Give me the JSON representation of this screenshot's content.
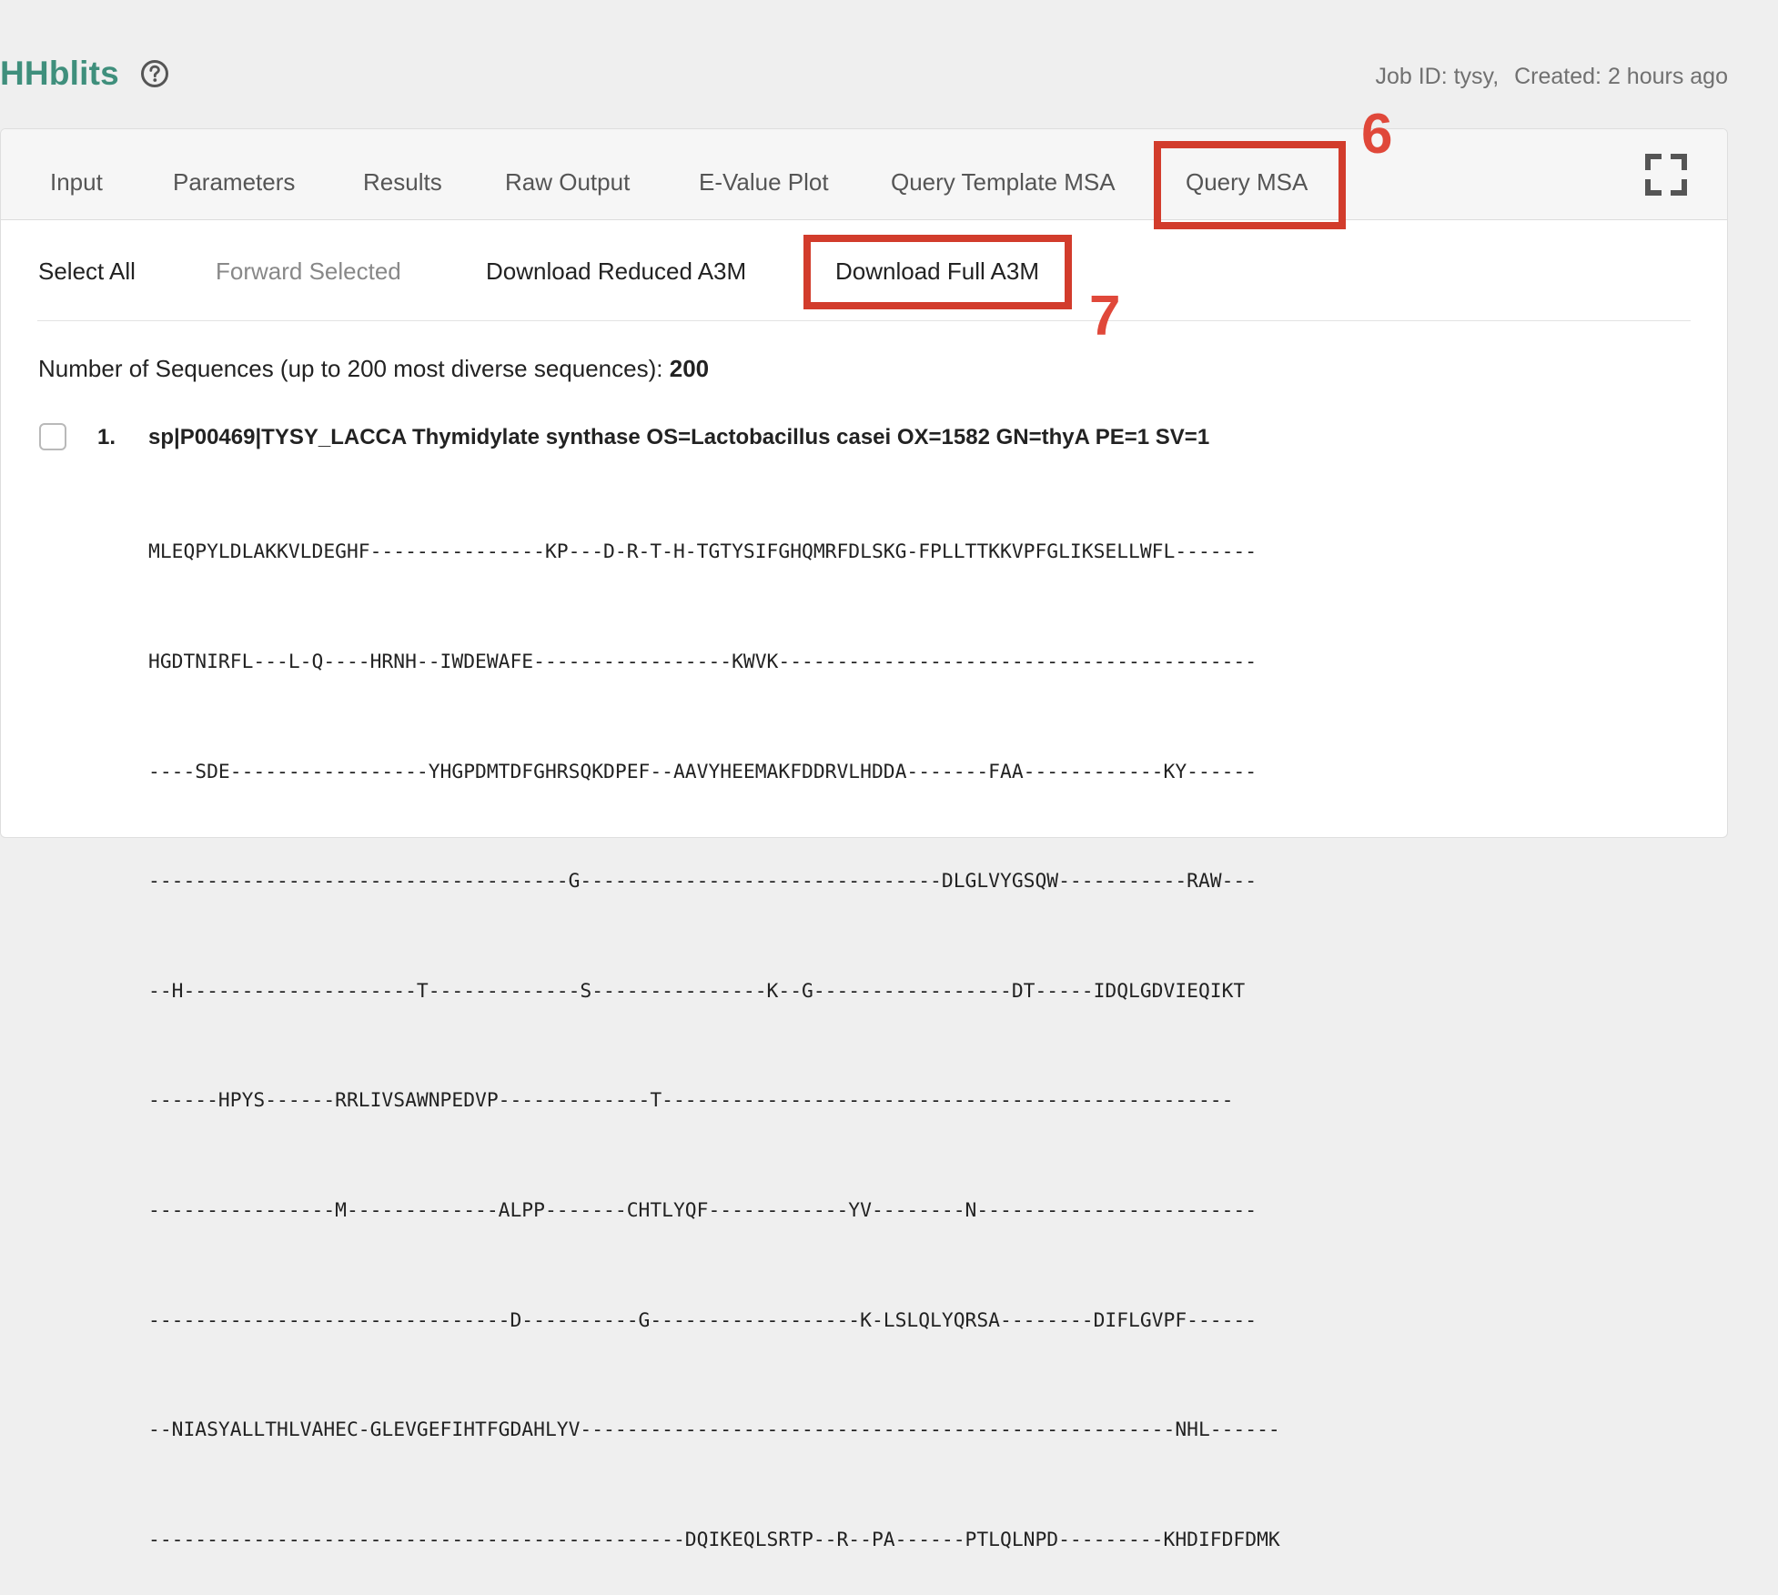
{
  "app": {
    "title": "HHblits",
    "job_id": "Job ID: tysy,",
    "created": "Created: 2 hours ago"
  },
  "tabs": [
    {
      "label": "Input"
    },
    {
      "label": "Parameters"
    },
    {
      "label": "Results"
    },
    {
      "label": "Raw Output"
    },
    {
      "label": "E-Value Plot"
    },
    {
      "label": "Query Template MSA"
    },
    {
      "label": "Query MSA",
      "active": true
    }
  ],
  "actions": {
    "select_all": "Select All",
    "forward_selected": "Forward Selected",
    "download_reduced": "Download Reduced A3M",
    "download_full": "Download Full A3M"
  },
  "annotations": {
    "six": "6",
    "seven": "7",
    "color": "#d23c2c"
  },
  "summary": {
    "label": "Number of Sequences (up to 200 most diverse sequences):",
    "value": "200"
  },
  "sequence": {
    "index": "1.",
    "header": "sp|P00469|TYSY_LACCA Thymidylate synthase OS=Lactobacillus casei OX=1582 GN=thyA PE=1 SV=1",
    "lines": [
      "MLEQPYLDLAKKVLDEGHF---------------KP---D-R-T-H-TGTYSIFGHQMRFDLSKG-FPLLTTKKVPFGLIKSELLWFL-------",
      "HGDTNIRFL---L-Q----HRNH--IWDEWAFE-----------------KWVK-----------------------------------------",
      "----SDE-----------------YHGPDMTDFGHRSQKDPEF--AAVYHEEMAKFDDRVLHDDA-------FAA------------KY------",
      "------------------------------------G-------------------------------DLGLVYGSQW-----------RAW---",
      "--H--------------------T-------------S---------------K--G-----------------DT-----IDQLGDVIEQIKT",
      "------HPYS------RRLIVSAWNPEDVP-------------T-------------------------------------------------",
      "----------------M-------------ALPP-------CHTLYQF------------YV--------N------------------------",
      "-------------------------------D----------G------------------K-LSLQLYQRSA--------DIFLGVPF------",
      "--NIASYALLTHLVAHEC-GLEVGEFIHTFGDAHLYV---------------------------------------------------NHL------",
      "----------------------------------------------DQIKEQLSRTP--R--PA------PTLQLNPD---------KHDIFDFDMK"
    ]
  }
}
